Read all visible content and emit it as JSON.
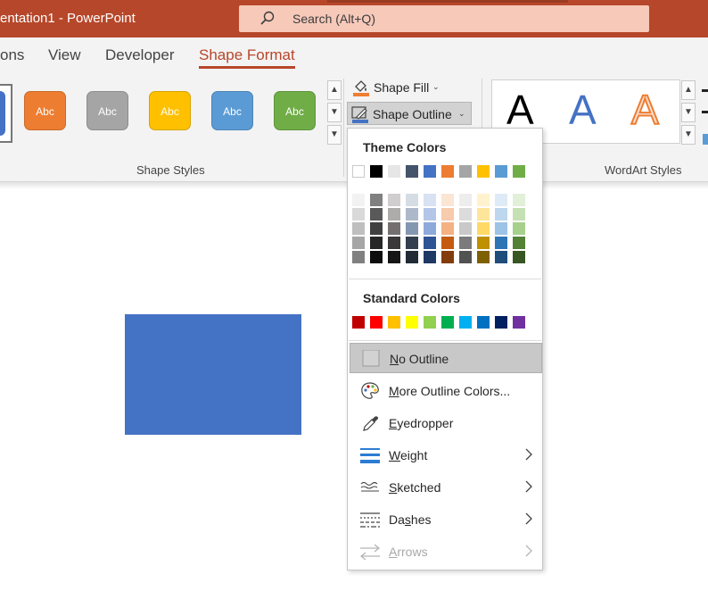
{
  "titlebar": {
    "title": "entation1  -  PowerPoint",
    "search_placeholder": "Search (Alt+Q)",
    "search_icon": "search-icon"
  },
  "tabs": [
    {
      "label": "ons"
    },
    {
      "label": "View"
    },
    {
      "label": "Developer"
    },
    {
      "label": "Shape Format",
      "active": true
    }
  ],
  "shape_styles": {
    "group_label": "Shape Styles",
    "items": [
      {
        "label": "Abc",
        "color": "#ed7d31"
      },
      {
        "label": "Abc",
        "color": "#a5a5a5"
      },
      {
        "label": "Abc",
        "color": "#ffc000"
      },
      {
        "label": "Abc",
        "color": "#5b9bd5"
      },
      {
        "label": "Abc",
        "color": "#70ad47"
      }
    ]
  },
  "commands": {
    "shape_fill": "Shape Fill",
    "shape_outline": "Shape Outline"
  },
  "wordart": {
    "group_label": "WordArt Styles",
    "samples": [
      "A",
      "A",
      "A"
    ]
  },
  "menu": {
    "theme_colors_heading": "Theme Colors",
    "standard_colors_heading": "Standard Colors",
    "theme_row": [
      "#ffffff",
      "#000000",
      "#e7e6e6",
      "#44546a",
      "#4472c4",
      "#ed7d31",
      "#a5a5a5",
      "#ffc000",
      "#5b9bd5",
      "#70ad47"
    ],
    "theme_shades": [
      [
        "#f2f2f2",
        "#d9d9d9",
        "#bfbfbf",
        "#a6a6a6",
        "#808080"
      ],
      [
        "#808080",
        "#595959",
        "#404040",
        "#262626",
        "#0d0d0d"
      ],
      [
        "#d0cece",
        "#aeabab",
        "#757070",
        "#3a3838",
        "#171616"
      ],
      [
        "#d6dce4",
        "#adb9ca",
        "#8497b0",
        "#333f4f",
        "#222a35"
      ],
      [
        "#d9e2f3",
        "#b4c6e7",
        "#8eaadb",
        "#2f5496",
        "#1f3864"
      ],
      [
        "#fbe5d5",
        "#f7cbac",
        "#f4b183",
        "#c55a11",
        "#833c0b"
      ],
      [
        "#ededed",
        "#dbdbdb",
        "#c9c9c9",
        "#7b7b7b",
        "#525252"
      ],
      [
        "#fff2cc",
        "#fee599",
        "#ffd966",
        "#bf9000",
        "#7f6000"
      ],
      [
        "#deebf6",
        "#bdd7ee",
        "#9dc3e6",
        "#2e75b5",
        "#1e4e79"
      ],
      [
        "#e2efd9",
        "#c5e0b3",
        "#a8d08d",
        "#538135",
        "#375623"
      ]
    ],
    "standard_row": [
      "#c00000",
      "#ff0000",
      "#ffc000",
      "#ffff00",
      "#92d050",
      "#00b050",
      "#00b0f0",
      "#0070c0",
      "#002060",
      "#7030a0"
    ],
    "items": [
      {
        "label": "No Outline",
        "icon": "no-outline-icon"
      },
      {
        "label": "More Outline Colors...",
        "icon": "palette-icon"
      },
      {
        "label": "Eyedropper",
        "icon": "eyedropper-icon"
      },
      {
        "label": "Weight",
        "icon": "weight-icon"
      },
      {
        "label": "Sketched",
        "icon": "sketched-icon"
      },
      {
        "label": "Dashes",
        "icon": "dashes-icon"
      },
      {
        "label": "Arrows",
        "icon": "arrows-icon"
      }
    ]
  }
}
